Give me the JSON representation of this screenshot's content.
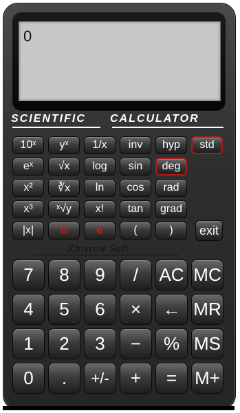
{
  "display": {
    "value": "0"
  },
  "brand": {
    "word1": "SCIENTIFIC",
    "word2": "CALCULATOR"
  },
  "author": "Khisrow Safi",
  "colors": {
    "body": "#333333",
    "screen": "#c8c8c8",
    "active_border": "#b01818",
    "red_text": "#cc1a1a"
  },
  "sci_keys": {
    "row1": [
      "10ˣ",
      "yˣ",
      "1/x",
      "inv",
      "hyp",
      "std"
    ],
    "row2": [
      "eˣ",
      "√x",
      "log",
      "sin",
      "deg"
    ],
    "row3": [
      "x²",
      "∛x",
      "ln",
      "cos",
      "rad"
    ],
    "row4": [
      "x³",
      "ˣ√y",
      "x!",
      "tan",
      "grad"
    ],
    "row5": [
      "|x|",
      "π",
      "e",
      "(",
      ")",
      "exit"
    ]
  },
  "num_keys": {
    "row1": [
      "7",
      "8",
      "9",
      "/",
      "AC",
      "MC"
    ],
    "row2": [
      "4",
      "5",
      "6",
      "×",
      "←",
      "MR"
    ],
    "row3": [
      "1",
      "2",
      "3",
      "−",
      "%",
      "MS"
    ],
    "row4": [
      "0",
      ".",
      "+/-",
      "+",
      "=",
      "M+"
    ]
  }
}
